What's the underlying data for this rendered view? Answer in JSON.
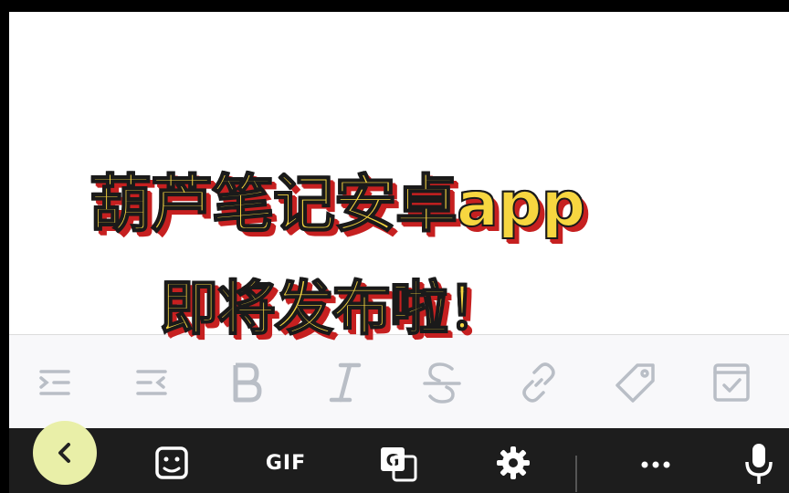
{
  "overlay": {
    "line1": "葫芦笔记安卓app",
    "line2": "即将发布啦！"
  },
  "format_toolbar": {
    "items": [
      "indent-icon",
      "outdent-icon",
      "bold-icon",
      "italic-icon",
      "strikethrough-icon",
      "link-icon",
      "tag-icon",
      "checklist-icon"
    ]
  },
  "keyboard_bar": {
    "gif_label": "GIF",
    "items": [
      "back-icon",
      "sticker-icon",
      "gif",
      "translate-icon",
      "settings-icon",
      "more-icon",
      "mic-icon"
    ]
  },
  "colors": {
    "title_fill": "#f7d640",
    "title_shadow": "#c62020",
    "toolbar_icon": "#b9bec6",
    "keyboard_bg": "#1d1d1d",
    "back_button_bg": "#e9efa8"
  }
}
